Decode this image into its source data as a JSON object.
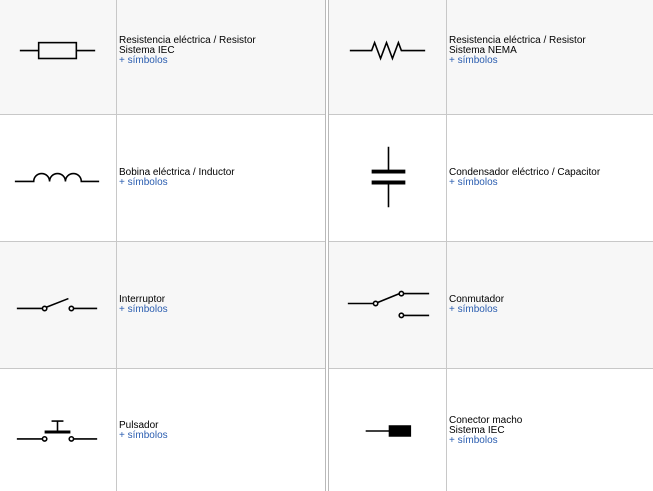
{
  "colors": {
    "link": "#2a5db0",
    "shaded_row": "#f7f7f7",
    "border": "#c8c8c8"
  },
  "rows": [
    {
      "left": {
        "icon": "resistor-iec-icon",
        "lines": [
          "Resistencia eléctrica / Resistor",
          "Sistema IEC"
        ],
        "link": "+ símbolos"
      },
      "right": {
        "icon": "resistor-nema-icon",
        "lines": [
          "Resistencia eléctrica / Resistor",
          "Sistema NEMA"
        ],
        "link": "+ símbolos"
      }
    },
    {
      "left": {
        "icon": "inductor-icon",
        "lines": [
          "Bobina eléctrica / Inductor"
        ],
        "link": "+ símbolos"
      },
      "right": {
        "icon": "capacitor-icon",
        "lines": [
          "Condensador eléctrico / Capacitor"
        ],
        "link": "+ símbolos"
      }
    },
    {
      "left": {
        "icon": "switch-icon",
        "lines": [
          "Interruptor"
        ],
        "link": "+ símbolos"
      },
      "right": {
        "icon": "changeover-switch-icon",
        "lines": [
          "Conmutador"
        ],
        "link": "+ símbolos"
      }
    },
    {
      "left": {
        "icon": "push-button-icon",
        "lines": [
          "Pulsador"
        ],
        "link": "+ símbolos"
      },
      "right": {
        "icon": "male-connector-icon",
        "lines": [
          "Conector macho",
          "Sistema IEC"
        ],
        "link": "+ símbolos"
      }
    }
  ]
}
